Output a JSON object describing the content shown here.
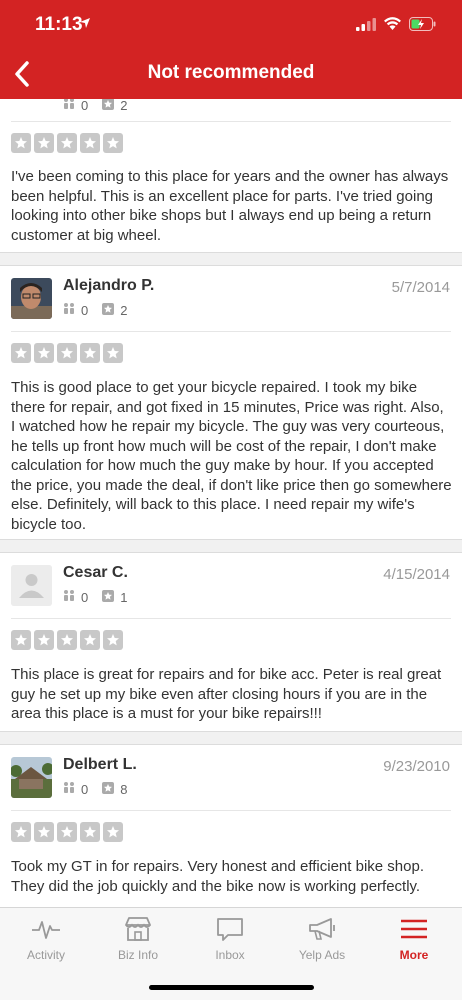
{
  "status_bar": {
    "time": "11:13"
  },
  "header": {
    "title": "Not recommended"
  },
  "reviews": [
    {
      "partial": true,
      "friends": "0",
      "reviews_count": "2",
      "text": "I've been coming to this place for years and the owner has always been helpful. This is an excellent place for parts. I've tried going looking into other bike shops but I always end up being a return customer at big wheel."
    },
    {
      "name": "Alejandro P.",
      "date": "5/7/2014",
      "friends": "0",
      "reviews_count": "2",
      "text": "This is good place to get your bicycle repaired. I took my bike there for repair, and got fixed in 15 minutes, Price was right. Also, I watched how he repair my bicycle. The guy was very courteous, he tells up front how much will be cost of the repair, I don't make calculation for how much the guy make by hour. If you accepted the price, you made the deal, if don't like price then go somewhere else. Definitely, will back to this place. I need repair my wife's bicycle too."
    },
    {
      "name": "Cesar C.",
      "date": "4/15/2014",
      "friends": "0",
      "reviews_count": "1",
      "text": "This place is great for repairs and for bike acc. Peter is real great guy he set up my bike even after closing hours if you are in the area this place is a must for your bike repairs!!!"
    },
    {
      "name": "Delbert L.",
      "date": "9/23/2010",
      "friends": "0",
      "reviews_count": "8",
      "text": "Took my GT in for repairs. Very honest and efficient bike shop. They did the job quickly and the bike now is working perfectly."
    }
  ],
  "tabs": [
    {
      "label": "Activity",
      "icon": "activity-icon"
    },
    {
      "label": "Biz Info",
      "icon": "store-icon"
    },
    {
      "label": "Inbox",
      "icon": "chat-bubble-icon"
    },
    {
      "label": "Yelp Ads",
      "icon": "megaphone-icon"
    },
    {
      "label": "More",
      "icon": "menu-icon",
      "active": true
    }
  ],
  "colors": {
    "brand": "#d32323",
    "star_empty": "#c8c8c8"
  }
}
